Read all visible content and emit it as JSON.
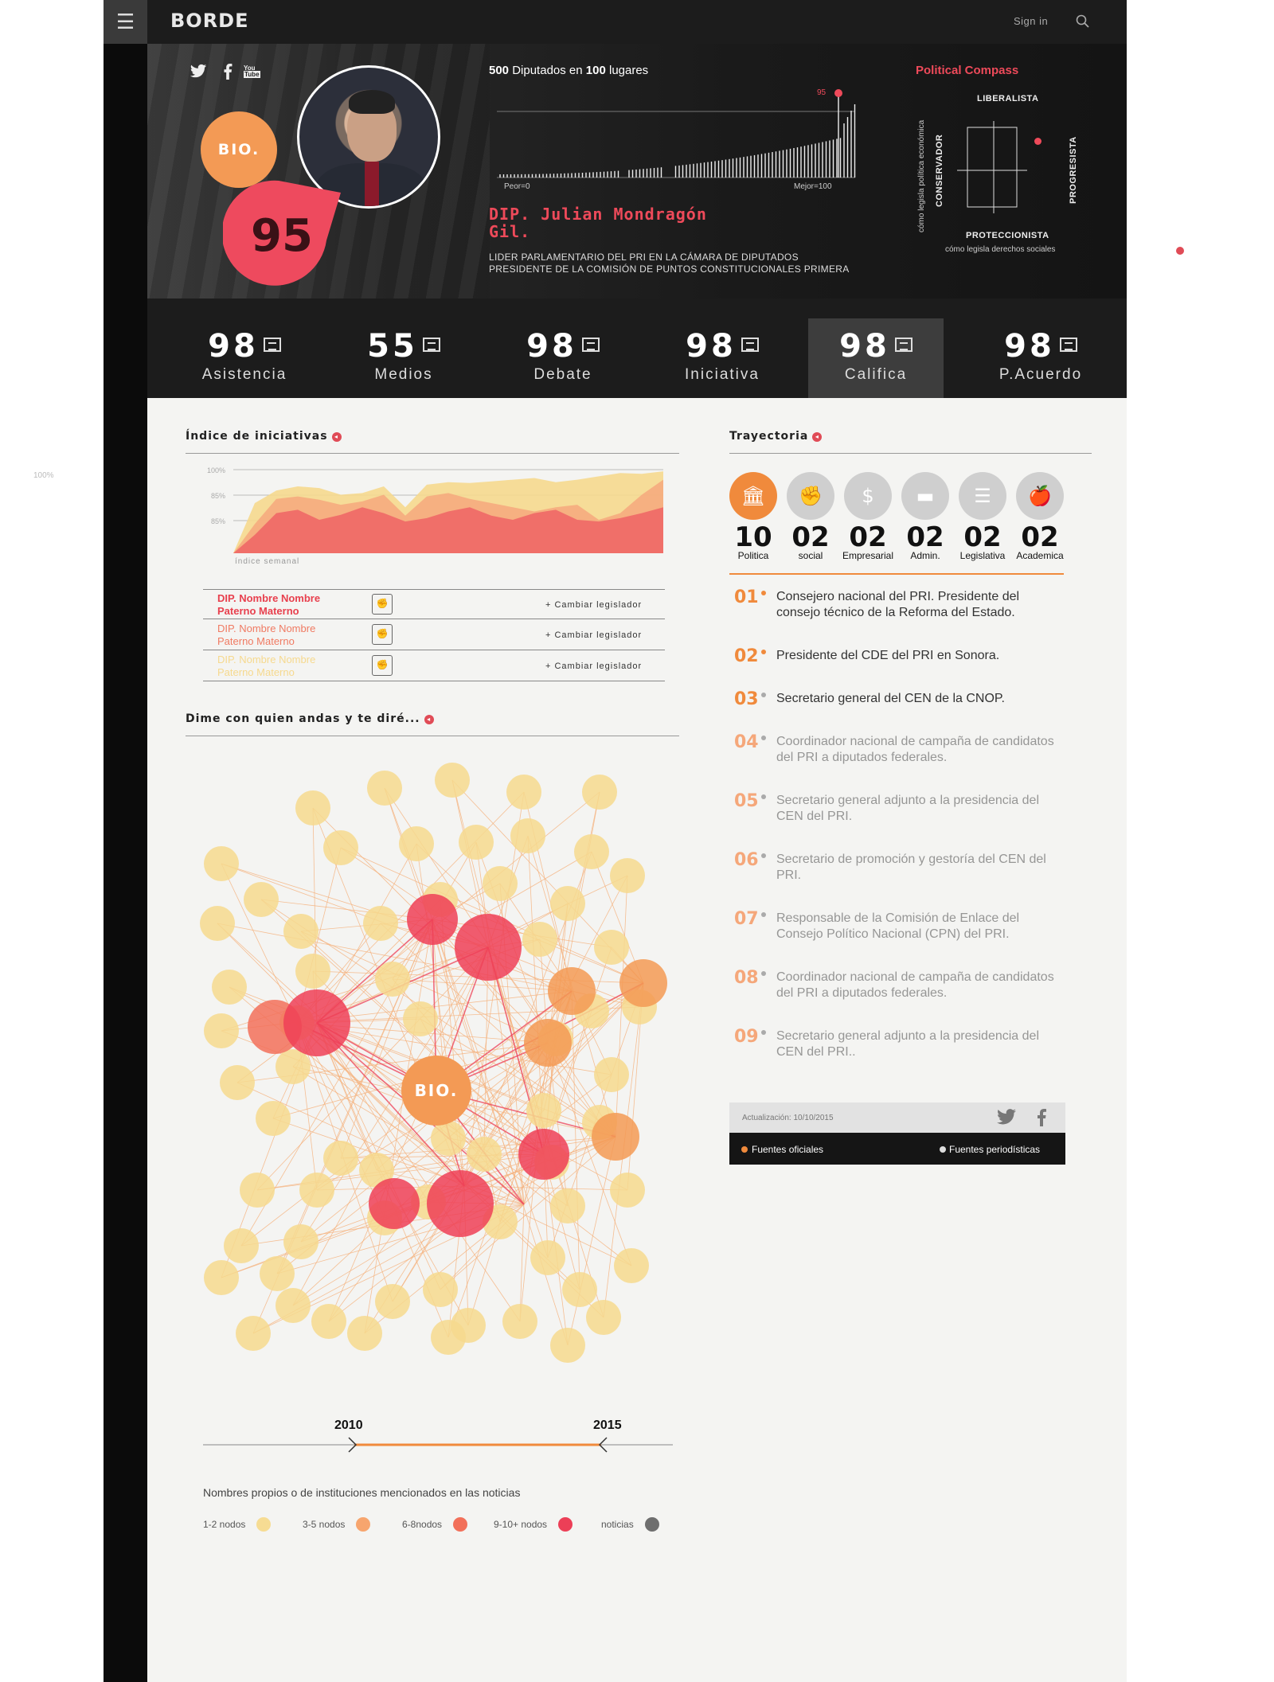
{
  "app": {
    "logo": "BORDE",
    "signin": "Sign in"
  },
  "hero": {
    "social": [
      "twitter-icon",
      "facebook-icon",
      "youtube-icon"
    ],
    "bio_label": "BIO.",
    "score": "95",
    "ranking_title_bold": "500",
    "ranking_title": "Diputados en",
    "ranking_title_bold2": "100",
    "ranking_title_end": "lugares",
    "ranking_marker": "95",
    "worst_label": "Peor=0",
    "best_label": "Mejor=100",
    "name": "DIP. Julian Mondragón Gil.",
    "role_line1": "LIDER PARLAMENTARIO DEL PRI EN LA CÁMARA DE DIPUTADOS",
    "role_line2": "PRESIDENTE DE LA COMISIÓN DE PUNTOS CONSTITUCIONALES PRIMERA",
    "compass": {
      "title": "Political Compass",
      "top": "LIBERALISTA",
      "bottom": "PROTECCIONISTA",
      "left": "CONSERVADOR",
      "right": "PROGRESISTA",
      "left_axis": "cómo legisla política económica",
      "bottom_axis": "cómo legisla derechos sociales"
    }
  },
  "stats": [
    {
      "value": "98",
      "label": "Asistencia"
    },
    {
      "value": "55",
      "label": "Medios"
    },
    {
      "value": "98",
      "label": "Debate"
    },
    {
      "value": "98",
      "label": "Iniciativa"
    },
    {
      "value": "98",
      "label": "Califica"
    },
    {
      "value": "98",
      "label": "P.Acuerdo"
    }
  ],
  "iniciativas": {
    "title": "Índice de iniciativas",
    "y_ticks": [
      "100%",
      "85%",
      "85%"
    ],
    "x_label": "índice semanal",
    "legislators": [
      {
        "name_line1": "DIP. Nombre Nombre",
        "name_line2": "Paterno Materno",
        "color": "#e8404e",
        "action": "+  Cambiar legislador"
      },
      {
        "name_line1": "DIP. Nombre Nombre",
        "name_line2": "Paterno Materno",
        "color": "#f07a62",
        "action": "+  Cambiar legislador"
      },
      {
        "name_line1": "DIP. Nombre Nombre",
        "name_line2": "Paterno Materno",
        "color": "#f6d98e",
        "action": "+  Cambiar legislador"
      }
    ]
  },
  "network": {
    "title": "Dime con quien andas y te diré...",
    "center": "BIO.",
    "year_start": "2010",
    "year_end": "2015",
    "caption": "Nombres propios o de instituciones mencionados en las noticias",
    "legend": [
      {
        "label": "1-2 nodos",
        "color": "#f6dc93"
      },
      {
        "label": "3-5 nodos",
        "color": "#f7a56e"
      },
      {
        "label": "6-8nodos",
        "color": "#f2705a"
      },
      {
        "label": "9-10+ nodos",
        "color": "#ec3f57"
      },
      {
        "label": "noticias",
        "color": "#6e6e6e"
      }
    ]
  },
  "trayectoria": {
    "title": "Trayectoria",
    "categories": [
      {
        "num": "10",
        "label": "Politica",
        "icon": "bank-icon"
      },
      {
        "num": "02",
        "label": "social",
        "icon": "fist-icon"
      },
      {
        "num": "02",
        "label": "Empresarial",
        "icon": "money-icon"
      },
      {
        "num": "02",
        "label": "Admin.",
        "icon": "folder-icon"
      },
      {
        "num": "02",
        "label": "Legislativa",
        "icon": "document-icon"
      },
      {
        "num": "02",
        "label": "Academica",
        "icon": "apple-book-icon"
      }
    ],
    "items": [
      {
        "n": "01",
        "text": "Consejero nacional del PRI. Presidente del consejo técnico de la Reforma del Estado."
      },
      {
        "n": "02",
        "text": "Presidente del CDE del PRI en Sonora."
      },
      {
        "n": "03",
        "text": "Secretario general del CEN de la CNOP."
      },
      {
        "n": "04",
        "text": "Coordinador nacional de campaña de candidatos del PRI a diputados federales."
      },
      {
        "n": "05",
        "text": "Secretario general adjunto a la presidencia del CEN del PRI."
      },
      {
        "n": "06",
        "text": "Secretario de promoción y gestoría del CEN del PRI."
      },
      {
        "n": "07",
        "text": "Responsable de la Comisión de Enlace del Consejo Político Nacional (CPN) del PRI."
      },
      {
        "n": "08",
        "text": "Coordinador nacional de campaña de candidatos del PRI a diputados federales."
      },
      {
        "n": "09",
        "text": "Secretario general adjunto a la presidencia del CEN del PRI.."
      }
    ],
    "updated": "Actualización: 10/10/2015",
    "source_official": "Fuentes oficiales",
    "source_press": "Fuentes periodísticas"
  },
  "side_note": "100%"
}
